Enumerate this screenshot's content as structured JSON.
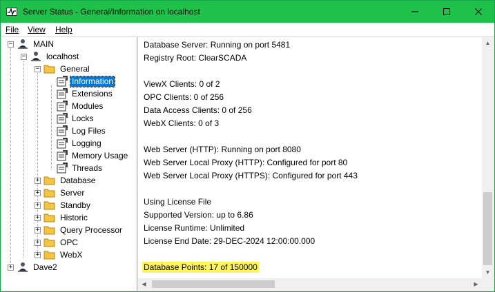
{
  "window": {
    "title": "Server Status - General/Information on localhost",
    "controls": {
      "minimize": "minimize-icon",
      "maximize": "maximize-icon",
      "close": "close-icon"
    }
  },
  "menu": {
    "file": "File",
    "view": "View",
    "help": "Help"
  },
  "tree": {
    "main": "MAIN",
    "localhost": "localhost",
    "general": "General",
    "general_children": [
      "Information",
      "Extensions",
      "Modules",
      "Locks",
      "Log Files",
      "Logging",
      "Memory Usage",
      "Threads"
    ],
    "siblings": [
      "Database",
      "Server",
      "Standby",
      "Historic",
      "Query Processor",
      "OPC",
      "WebX"
    ],
    "dave2": "Dave2",
    "selected": "Information"
  },
  "info": {
    "database_server": "Database Server: Running on port 5481",
    "registry_root": "Registry Root: ClearSCADA",
    "viewx_clients": "ViewX Clients: 0 of 2",
    "opc_clients": "OPC Clients: 0 of 256",
    "data_access_clients": "Data Access Clients: 0 of 256",
    "webx_clients": "WebX Clients: 0 of 3",
    "web_server_http": "Web Server (HTTP): Running on port 8080",
    "proxy_http": "Web Server Local Proxy (HTTP): Configured for port 80",
    "proxy_https": "Web Server Local Proxy (HTTPS): Configured for port 443",
    "license_file": "Using License File",
    "supported_version": "Supported Version: up to 6.86",
    "license_runtime": "License Runtime: Unlimited",
    "license_end": "License End Date: 29-DEC-2024 12:00:00.000",
    "database_points": "Database Points: 17 of 150000"
  },
  "colors": {
    "titlebar": "#1ec24a",
    "selection": "#0078d7",
    "highlight": "#fff55a",
    "folder": "#f5c542"
  }
}
